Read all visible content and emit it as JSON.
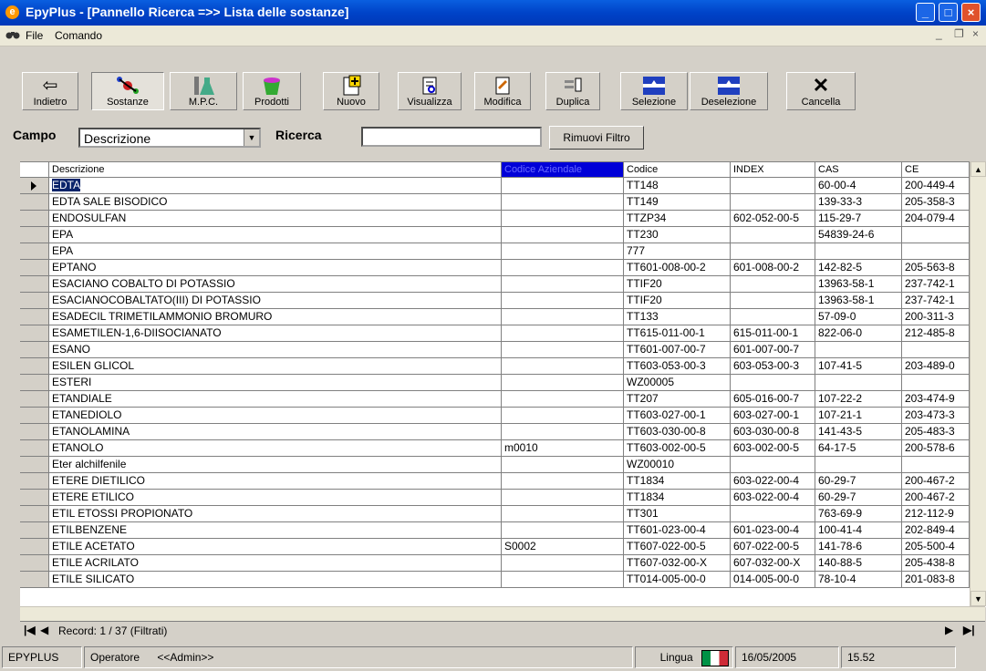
{
  "window": {
    "title": "EpyPlus - [Pannello Ricerca =>> Lista delle sostanze]",
    "icon": "app-icon",
    "controls": [
      "minimize",
      "maximize",
      "close"
    ]
  },
  "menubar": {
    "icon": "binoculars-icon",
    "items": [
      "File",
      "Comando"
    ],
    "mdi_controls": [
      "_",
      "❐",
      "×"
    ]
  },
  "toolbar": {
    "buttons": [
      {
        "label": "Indietro",
        "icon": "back-arrow-icon"
      },
      {
        "label": "Sostanze",
        "icon": "molecule-icon"
      },
      {
        "label": "M.P.C.",
        "icon": "flask-icon"
      },
      {
        "label": "Prodotti",
        "icon": "bucket-icon"
      },
      {
        "label": "Nuovo",
        "icon": "new-doc-icon"
      },
      {
        "label": "Visualizza",
        "icon": "view-doc-icon"
      },
      {
        "label": "Modifica",
        "icon": "edit-doc-icon"
      },
      {
        "label": "Duplica",
        "icon": "duplicate-icon"
      },
      {
        "label": "Selezione",
        "icon": "select-icon"
      },
      {
        "label": "Deselezione",
        "icon": "deselect-icon"
      },
      {
        "label": "Cancella",
        "icon": "delete-x-icon"
      }
    ]
  },
  "search": {
    "campo_label": "Campo",
    "campo_value": "Descrizione",
    "ricerca_label": "Ricerca",
    "ricerca_value": "",
    "rimuovi_label": "Rimuovi Filtro"
  },
  "table": {
    "columns": [
      "Descrizione",
      "Codice Aziendale",
      "Codice",
      "INDEX",
      "CAS",
      "CE"
    ],
    "rows": [
      [
        "EDTA",
        "",
        "TT148",
        "",
        "60-00-4",
        "200-449-4"
      ],
      [
        "EDTA SALE BISODICO",
        "",
        "TT149",
        "",
        "139-33-3",
        "205-358-3"
      ],
      [
        "ENDOSULFAN",
        "",
        "TTZP34",
        "602-052-00-5",
        "115-29-7",
        "204-079-4"
      ],
      [
        "EPA",
        "",
        "TT230",
        "",
        "54839-24-6",
        ""
      ],
      [
        "EPA",
        "",
        "777",
        "",
        "",
        ""
      ],
      [
        "EPTANO",
        "",
        "TT601-008-00-2",
        "601-008-00-2",
        "142-82-5",
        "205-563-8"
      ],
      [
        "ESACIANO COBALTO DI POTASSIO",
        "",
        "TTIF20",
        "",
        "13963-58-1",
        "237-742-1"
      ],
      [
        "ESACIANOCOBALTATO(III) DI POTASSIO",
        "",
        "TTIF20",
        "",
        "13963-58-1",
        "237-742-1"
      ],
      [
        "ESADECIL TRIMETILAMMONIO BROMURO",
        "",
        "TT133",
        "",
        "57-09-0",
        "200-311-3"
      ],
      [
        "ESAMETILEN-1,6-DIISOCIANATO",
        "",
        "TT615-011-00-1",
        "615-011-00-1",
        "822-06-0",
        "212-485-8"
      ],
      [
        "ESANO",
        "",
        "TT601-007-00-7",
        "601-007-00-7",
        "",
        ""
      ],
      [
        "ESILEN GLICOL",
        "",
        "TT603-053-00-3",
        "603-053-00-3",
        "107-41-5",
        "203-489-0"
      ],
      [
        "ESTERI",
        "",
        "WZ00005",
        "",
        "",
        ""
      ],
      [
        "ETANDIALE",
        "",
        "TT207",
        "605-016-00-7",
        "107-22-2",
        "203-474-9"
      ],
      [
        "ETANEDIOLO",
        "",
        "TT603-027-00-1",
        "603-027-00-1",
        "107-21-1",
        "203-473-3"
      ],
      [
        "ETANOLAMINA",
        "",
        "TT603-030-00-8",
        "603-030-00-8",
        "141-43-5",
        "205-483-3"
      ],
      [
        "ETANOLO",
        "m0010",
        "TT603-002-00-5",
        "603-002-00-5",
        "64-17-5",
        "200-578-6"
      ],
      [
        "Eter alchilfenile",
        "",
        "WZ00010",
        "",
        "",
        ""
      ],
      [
        "ETERE DIETILICO",
        "",
        "TT1834",
        "603-022-00-4",
        "60-29-7",
        "200-467-2"
      ],
      [
        "ETERE ETILICO",
        "",
        "TT1834",
        "603-022-00-4",
        "60-29-7",
        "200-467-2"
      ],
      [
        "ETIL ETOSSI PROPIONATO",
        "",
        "TT301",
        "",
        "763-69-9",
        "212-112-9"
      ],
      [
        "ETILBENZENE",
        "",
        "TT601-023-00-4",
        "601-023-00-4",
        "100-41-4",
        "202-849-4"
      ],
      [
        "ETILE ACETATO",
        "S0002",
        "TT607-022-00-5",
        "607-022-00-5",
        "141-78-6",
        "205-500-4"
      ],
      [
        "ETILE ACRILATO",
        "",
        "TT607-032-00-X",
        "607-032-00-X",
        "140-88-5",
        "205-438-8"
      ],
      [
        "ETILE SILICATO",
        "",
        "TT014-005-00-0",
        "014-005-00-0",
        "78-10-4",
        "201-083-8"
      ]
    ]
  },
  "nav": {
    "record_text": "Record: 1 / 37 (Filtrati)"
  },
  "status": {
    "app": "EPYPLUS",
    "operatore_label": "Operatore",
    "operatore_value": "<<Admin>>",
    "lingua_label": "Lingua",
    "date": "16/05/2005",
    "time": "15.52"
  }
}
